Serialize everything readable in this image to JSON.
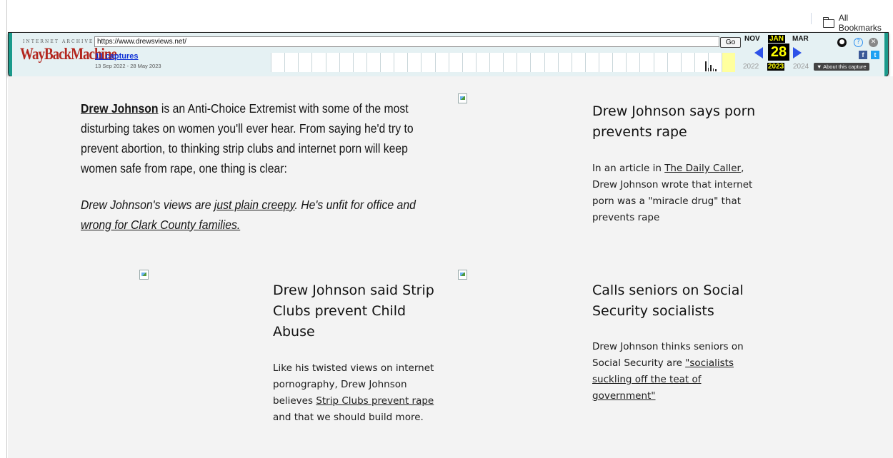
{
  "browser": {
    "bookmarks_label": "All Bookmarks"
  },
  "wayback": {
    "ia_label": "INTERNET ARCHIVE",
    "logo_text": "WayBackMachine",
    "url": "https://www.drewsviews.net/",
    "go_label": "Go",
    "captures_label": "11 captures",
    "date_range": "13 Sep 2022 - 28 May 2023",
    "months": {
      "prev": "NOV",
      "current": "JAN",
      "next": "MAR"
    },
    "day": "28",
    "years": {
      "prev": "2022",
      "current": "2023",
      "next": "2024"
    },
    "about_label": "▼ About this capture",
    "icons": [
      "user-icon",
      "help-icon",
      "close-icon",
      "facebook-icon",
      "twitter-icon"
    ],
    "accent_color": "#1a9a8b"
  },
  "page": {
    "intro": {
      "name_link": "Drew Johnson",
      "text": " is an Anti-Choice Extremist with some of the most disturbing takes on women you'll ever hear. From saying he'd try to prevent abortion, to thinking strip clubs and internet porn will keep women safe from rape, one thing is clear:"
    },
    "tagline": {
      "part1": "Drew Johnson's views are ",
      "link1": "just plain creepy",
      "part2": ". He's unfit for office and ",
      "link2": "wrong for Clark County families."
    },
    "cards": [
      {
        "title": "Drew Johnson says porn prevents rape",
        "body_pre": "In an article in ",
        "body_link": "The Daily Caller",
        "body_post": ", Drew Johnson wrote that internet porn was a \"miracle drug\" that prevents rape"
      },
      {
        "title": "Drew Johnson said Strip Clubs prevent Child Abuse",
        "body_pre": "Like his twisted views on internet pornography, Drew Johnson believes ",
        "body_link": "Strip Clubs prevent rape",
        "body_post": " and that we should build more."
      },
      {
        "title": "Calls seniors on Social Security socialists",
        "body_pre": "Drew Johnson thinks seniors on Social Security are ",
        "body_link": "\"socialists suckling off the teat of government\"",
        "body_post": ""
      }
    ]
  }
}
